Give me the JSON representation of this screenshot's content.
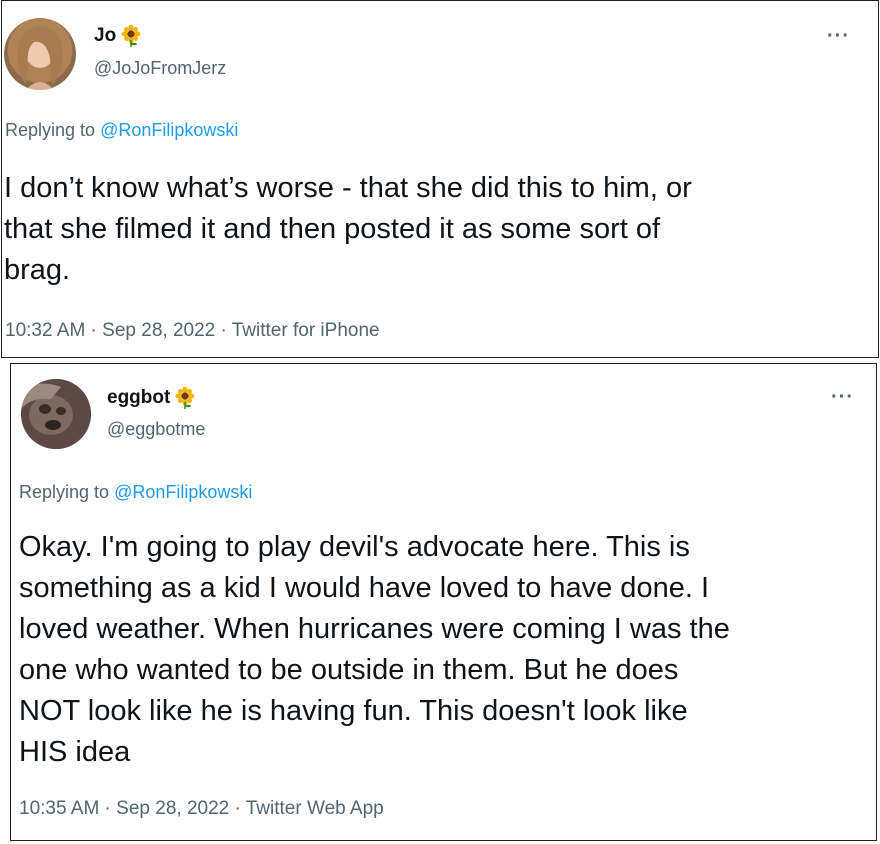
{
  "tweets": [
    {
      "name": "Jo",
      "handle": "@JoJoFromJerz",
      "replying_prefix": "Replying to ",
      "replying_to": "@RonFilipkowski",
      "lines": [
        "I don’t know what’s worse - that she did this to him, or",
        "that she filmed it and then posted it as some sort of",
        "brag."
      ],
      "meta": "10:32 AM · Sep 28, 2022 · Twitter for iPhone",
      "more": "···"
    },
    {
      "name": "eggbot",
      "handle": "@eggbotme",
      "replying_prefix": "Replying to ",
      "replying_to": "@RonFilipkowski",
      "lines": [
        "Okay. I'm going to play devil's advocate here. This is",
        "something as a kid I would have loved to have done. I",
        "loved weather. When hurricanes were coming I was the",
        "one who wanted to be outside in them. But he does",
        "NOT look like he is having fun. This doesn't look like",
        "HIS idea"
      ],
      "meta": "10:35 AM · Sep 28, 2022 · Twitter Web App",
      "more": "···"
    }
  ],
  "colors": {
    "text": "#0f1419",
    "secondary": "#536471",
    "mention": "#1d9bf0",
    "border": "#222222"
  },
  "icons": {
    "name_badge": "sunflower-icon",
    "menu": "more-options-icon"
  }
}
